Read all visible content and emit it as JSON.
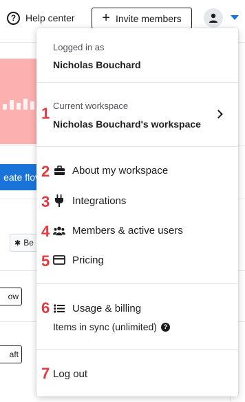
{
  "topbar": {
    "help_label": "Help center",
    "invite_label": "Invite members",
    "help_icon": "question-circle-icon",
    "invite_icon": "plus-icon",
    "avatar_icon": "user-icon",
    "caret_icon": "chevron-down-icon",
    "accent_color": "#1a73d8"
  },
  "background": {
    "create_label": "eate flov",
    "chip_label": "Be",
    "button1_label": "ow",
    "button2_label": "aft"
  },
  "menu": {
    "logged_in_label": "Logged in as",
    "user_name": "Nicholas Bouchard",
    "current_workspace_label": "Current workspace",
    "workspace_name": "Nicholas Bouchard's workspace",
    "items": [
      {
        "label": "About my workspace",
        "icon": "briefcase-icon"
      },
      {
        "label": "Integrations",
        "icon": "plug-icon"
      },
      {
        "label": "Members & active users",
        "icon": "users-icon"
      },
      {
        "label": "Pricing",
        "icon": "credit-card-icon"
      },
      {
        "label": "Usage & billing",
        "icon": "list-icon"
      }
    ],
    "sync_label": "Items in sync (unlimited)",
    "logout_label": "Log out"
  },
  "annotations": [
    "1",
    "2",
    "3",
    "4",
    "5",
    "6",
    "7"
  ],
  "annotation_color": "#e8373f"
}
